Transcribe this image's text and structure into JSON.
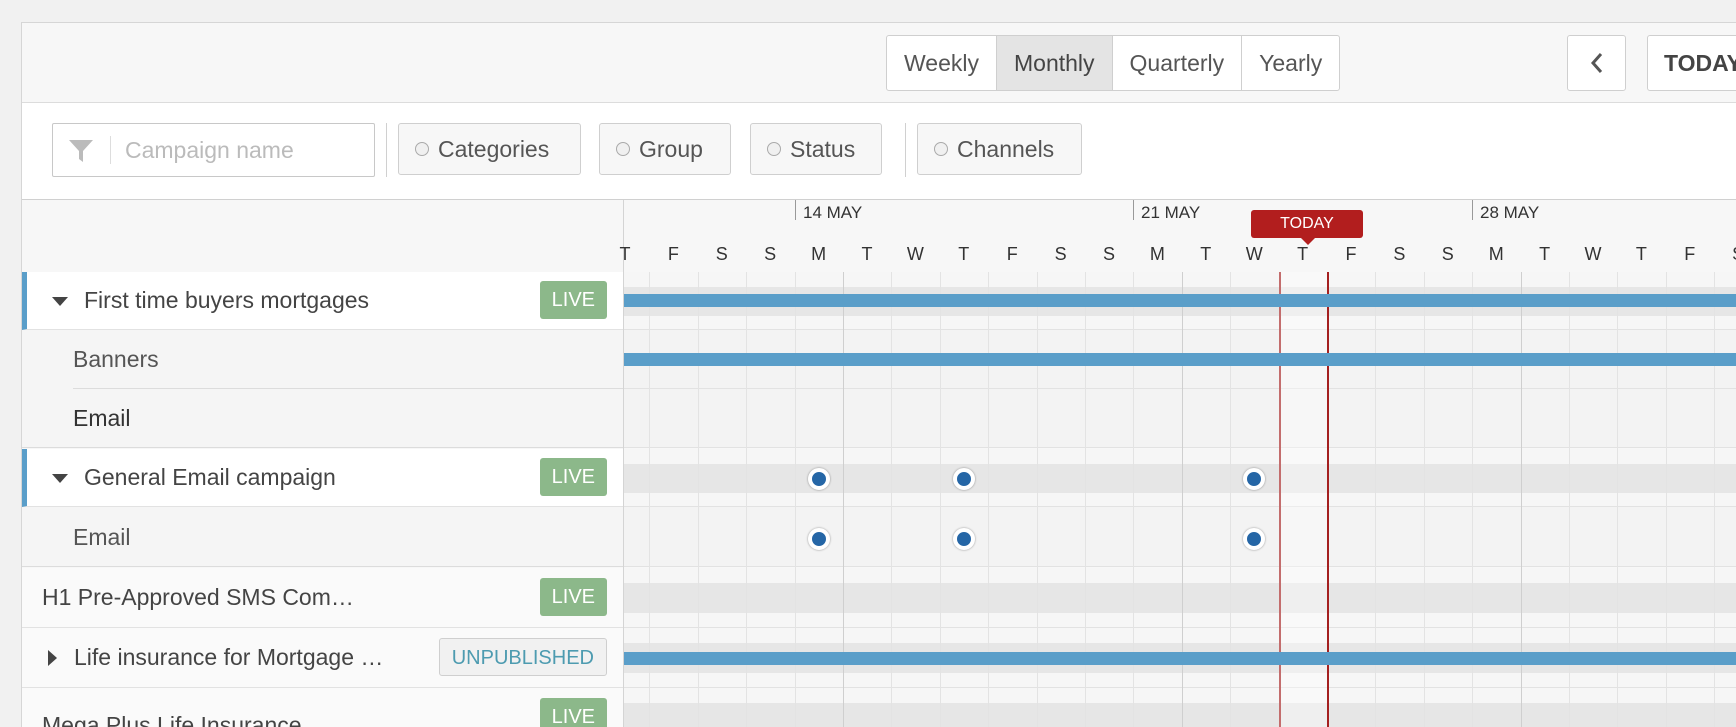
{
  "view_tabs": [
    "Weekly",
    "Monthly",
    "Quarterly",
    "Yearly"
  ],
  "active_view": "Monthly",
  "nav": {
    "prev_icon": "chevron-left-icon",
    "today_label": "TODAY"
  },
  "filters": {
    "search_placeholder": "Campaign name",
    "buttons": [
      "Categories",
      "Group",
      "Status",
      "Channels"
    ]
  },
  "timeline": {
    "weeks": [
      "14 MAY",
      "21 MAY",
      "28 MAY"
    ],
    "day_letters": [
      "T",
      "F",
      "S",
      "S",
      "M",
      "T",
      "W",
      "T",
      "F",
      "S",
      "S",
      "M",
      "T",
      "W",
      "T",
      "F",
      "S",
      "S",
      "M",
      "T",
      "W",
      "T",
      "F",
      "S"
    ],
    "today_tag": "TODAY"
  },
  "rows": [
    {
      "label": "First time buyers mortgages",
      "status": "LIVE",
      "expanded": true
    },
    {
      "label": "Banners"
    },
    {
      "label": "Email"
    },
    {
      "label": "General Email campaign",
      "status": "LIVE",
      "expanded": true
    },
    {
      "label": "Email"
    },
    {
      "label": "H1 Pre-Approved SMS Com…",
      "status": "LIVE"
    },
    {
      "label": "Life insurance for Mortgage …",
      "status": "UNPUBLISHED",
      "expanded": false
    },
    {
      "label": "Mega Plus Life Insurance",
      "status": "LIVE"
    }
  ],
  "colors": {
    "accent_blue": "#5a9ec9",
    "live_green": "#8cb88a",
    "today_red": "#b21e1e",
    "dot_blue": "#2566a6",
    "unpublished_text": "#4d9bb0"
  }
}
